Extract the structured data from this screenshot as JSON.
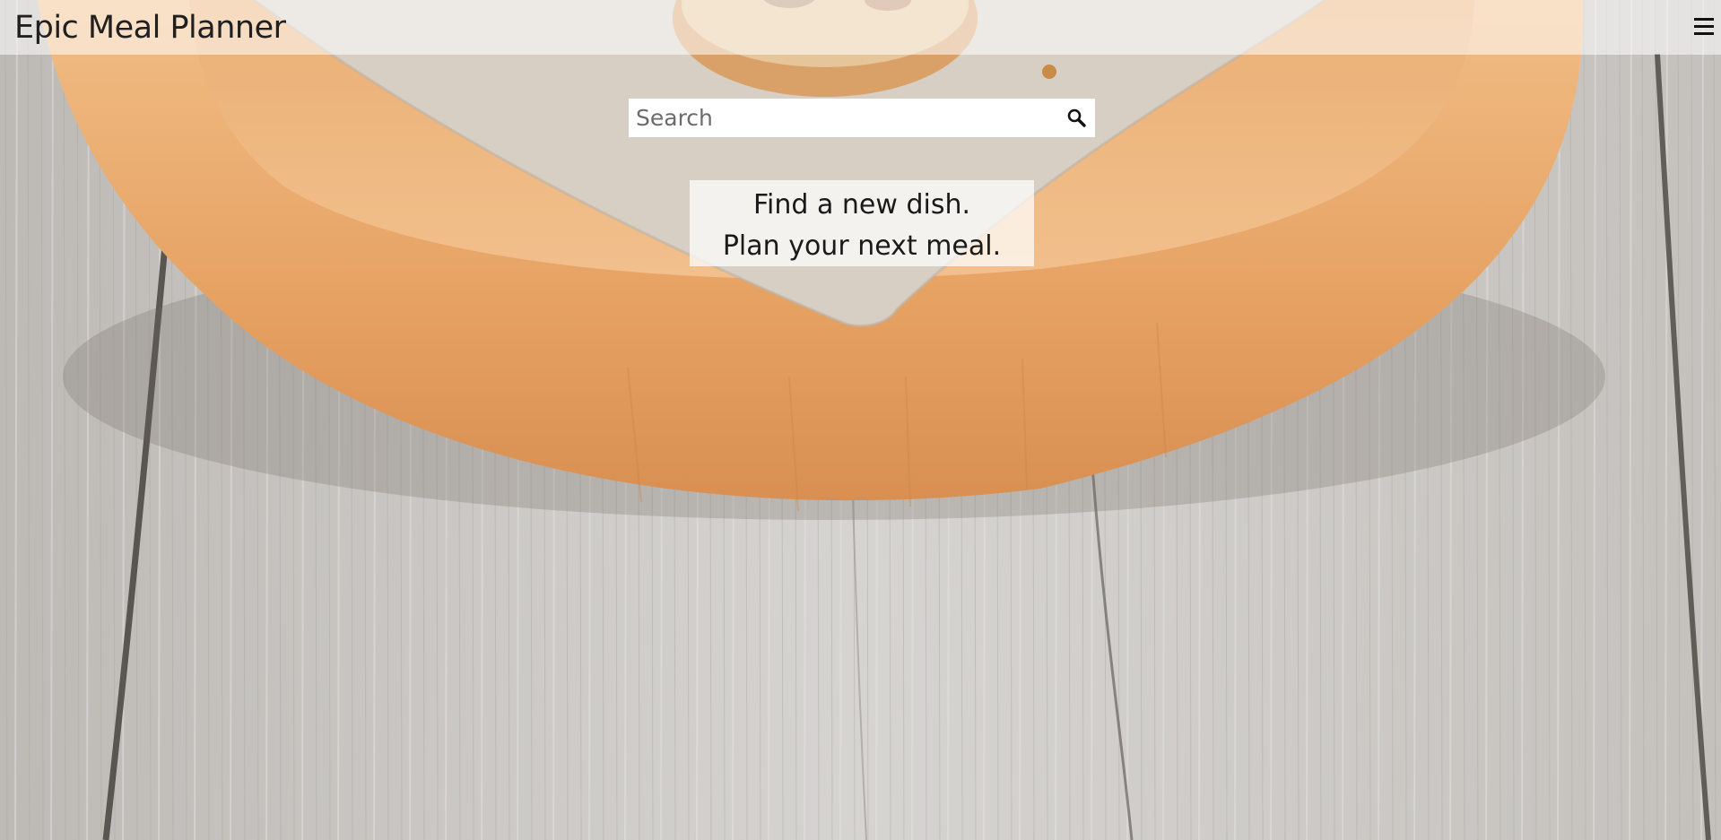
{
  "header": {
    "brand": "Epic Meal Planner",
    "menu_icon": "hamburger-menu-icon"
  },
  "search": {
    "placeholder": "Search",
    "value": "",
    "button_icon": "search-icon"
  },
  "hero": {
    "line1": "Find a new dish.",
    "line2": "Plan your next meal."
  },
  "colors": {
    "header_overlay": "#ffffff",
    "text": "#1a1a1a",
    "wood_plate": "#e7a66a",
    "table_wood": "#cfcdca"
  }
}
